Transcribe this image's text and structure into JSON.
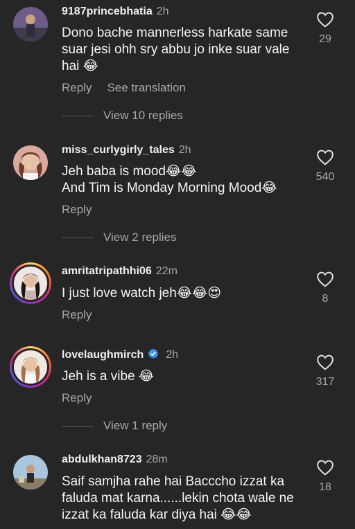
{
  "comments": [
    {
      "username": "9187princebhatia",
      "time": "2h",
      "text": "Dono bache mannerless harkate same suar jesi ohh sry abbu jo inke suar vale hai 😂",
      "reply_label": "Reply",
      "translate_label": "See translation",
      "likes": "29",
      "view_replies": "View 10 replies"
    },
    {
      "username": "miss_curlygirly_tales",
      "time": "2h",
      "text_line1": "Jeh baba is mood😂😂",
      "text_line2": "And Tim is Monday Morning Mood😂",
      "reply_label": "Reply",
      "likes": "540",
      "view_replies": "View 2 replies"
    },
    {
      "username": "amritatripathhi06",
      "time": "22m",
      "text": "I just love watch jeh😂😂😍",
      "reply_label": "Reply",
      "likes": "8"
    },
    {
      "username": "lovelaughmirch",
      "time": "2h",
      "text": "Jeh is a vibe 😂",
      "reply_label": "Reply",
      "likes": "317",
      "view_replies": "View 1 reply"
    },
    {
      "username": "abdulkhan8723",
      "time": "28m",
      "text": "Saif samjha rahe hai Bacccho izzat ka faluda mat karna......lekin chota wale ne izzat ka faluda kar diya hai 😂😂",
      "likes": "18"
    }
  ],
  "colors": {
    "background": "#262626",
    "secondary_text": "#a8a8a8",
    "verified_blue": "#3897f0"
  },
  "icons": {
    "like": "heart-outline-icon",
    "verified": "verified-badge-icon"
  }
}
